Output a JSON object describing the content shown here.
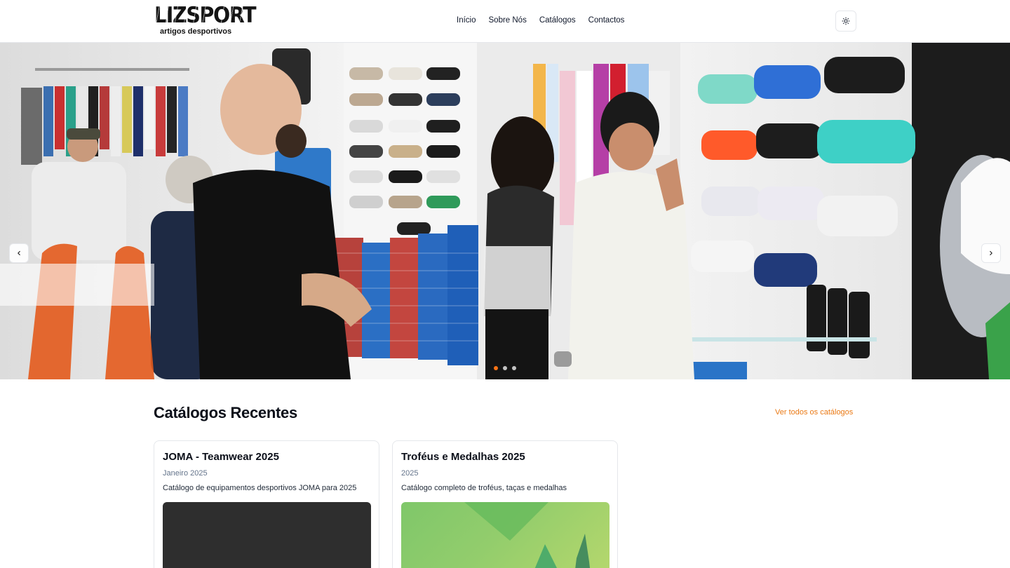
{
  "brand": {
    "name": "LIZSPORT",
    "tagline": "artigos desportivos"
  },
  "nav": {
    "items": [
      {
        "label": "Início"
      },
      {
        "label": "Sobre Nós"
      },
      {
        "label": "Catálogos"
      },
      {
        "label": "Contactos"
      }
    ]
  },
  "header": {
    "theme_toggle_icon": "sun-icon"
  },
  "hero": {
    "slide_count": 3,
    "active_slide": 1,
    "prev_icon": "chevron-left-icon",
    "next_icon": "chevron-right-icon"
  },
  "section": {
    "title": "Catálogos Recentes",
    "see_all_label": "Ver todos os catálogos"
  },
  "catalogs": [
    {
      "title": "JOMA - Teamwear 2025",
      "date": "Janeiro 2025",
      "description": "Catálogo de equipamentos desportivos JOMA para 2025"
    },
    {
      "title": "Troféus e Medalhas 2025",
      "date": "2025",
      "description": "Catálogo completo de troféus, taças e medalhas"
    }
  ],
  "colors": {
    "accent": "#f97316",
    "link": "#ea7a16",
    "text": "#0f172a",
    "muted": "#64748b"
  }
}
